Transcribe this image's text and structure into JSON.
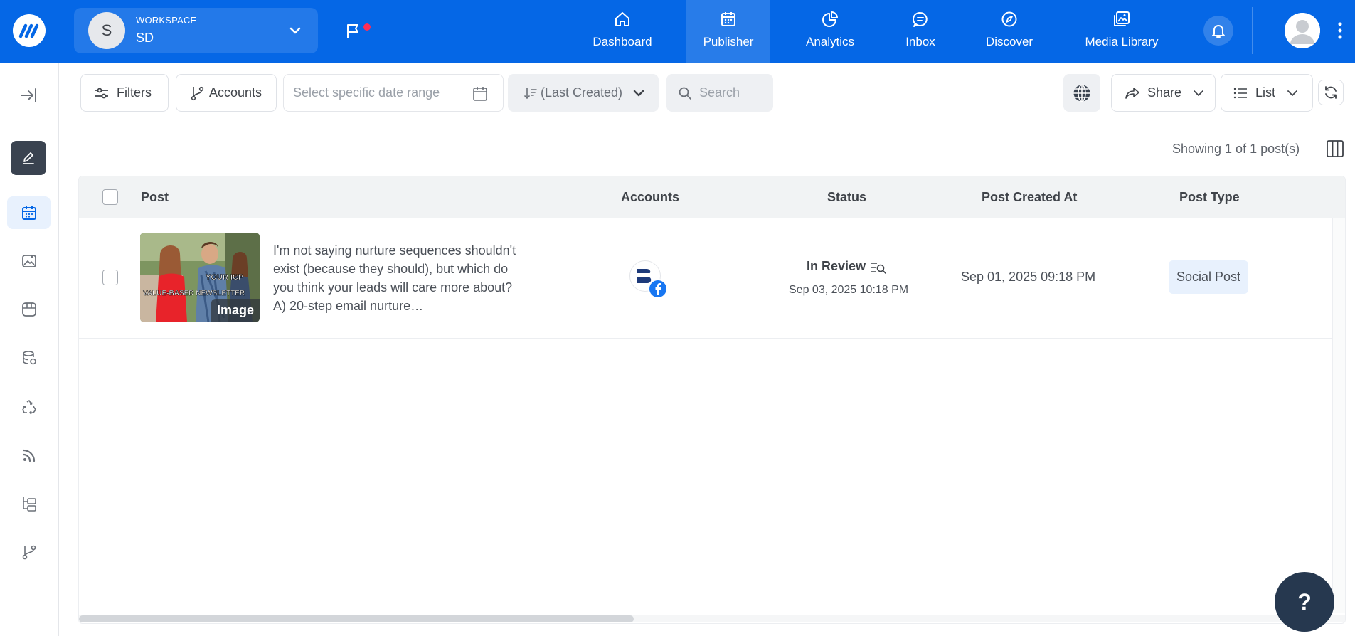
{
  "topbar": {
    "workspace_label": "WORKSPACE",
    "workspace_name": "SD",
    "workspace_initial": "S",
    "nav": [
      {
        "label": "Dashboard",
        "icon": "home-icon"
      },
      {
        "label": "Publisher",
        "icon": "calendar-icon",
        "active": true
      },
      {
        "label": "Analytics",
        "icon": "pie-chart-icon"
      },
      {
        "label": "Inbox",
        "icon": "chat-bubble-icon"
      },
      {
        "label": "Discover",
        "icon": "compass-icon"
      },
      {
        "label": "Media Library",
        "icon": "images-icon"
      }
    ],
    "brand_color": "#0567e6"
  },
  "sidebar": {
    "items": [
      "collapse-icon",
      "compose-icon",
      "calendar-icon",
      "image-edit-icon",
      "storefront-icon",
      "database-icon",
      "recycle-icon",
      "rss-icon",
      "folder-tree-icon",
      "git-branch-icon"
    ]
  },
  "toolbar": {
    "filters_label": "Filters",
    "accounts_label": "Accounts",
    "date_placeholder": "Select specific date range",
    "sort_label": "(Last Created)",
    "search_placeholder": "Search",
    "share_label": "Share",
    "view_label": "List"
  },
  "summary": {
    "showing": "Showing 1 of 1 post(s)"
  },
  "table": {
    "columns": [
      "Post",
      "Accounts",
      "Status",
      "Post Created At",
      "Post Type"
    ],
    "rows": [
      {
        "thumb_tag": "Image",
        "thumb_text_1": "YOUR ICP",
        "thumb_text_2": "VALUE-BASED NEWSLETTER",
        "text": "I'm not saying nurture sequences shouldn't exist (because they should), but which do you think your leads will care more about? A) 20-step email nurture…",
        "account_network": "facebook",
        "status": "In Review",
        "status_date": "Sep 03, 2025 10:18 PM",
        "created_at": "Sep 01, 2025 09:18 PM",
        "post_type": "Social Post"
      }
    ]
  },
  "help_label": "?"
}
